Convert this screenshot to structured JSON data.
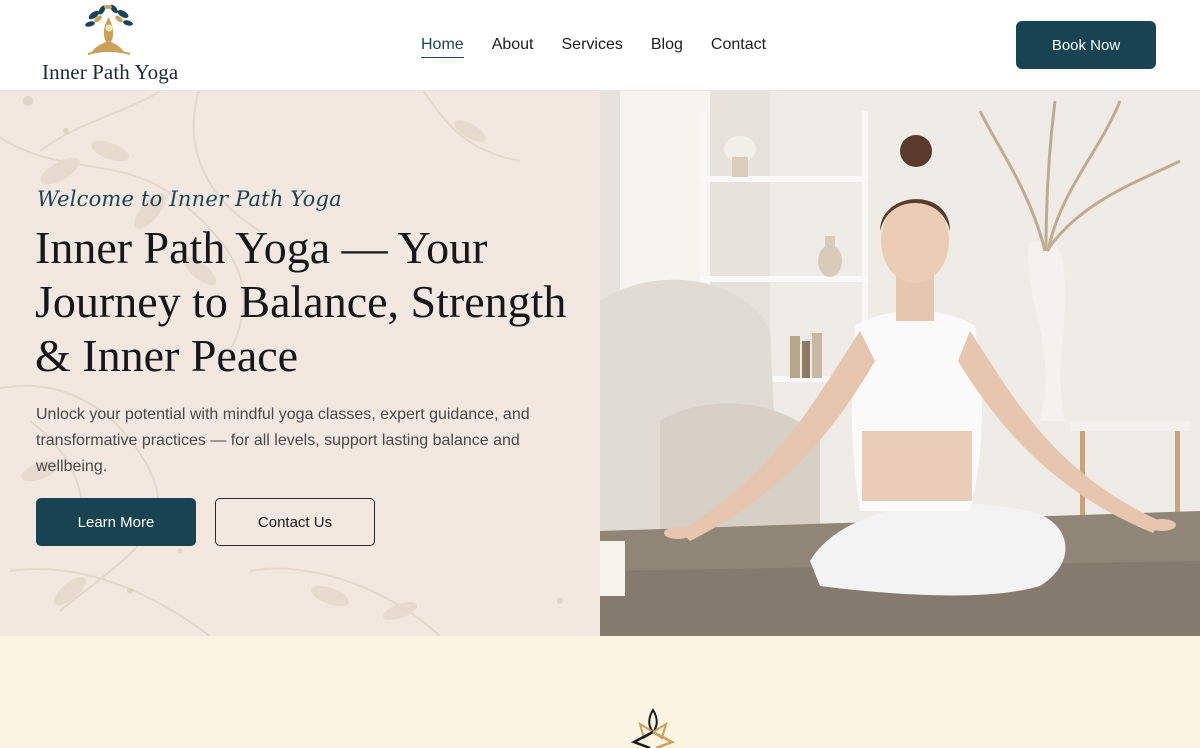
{
  "brand": {
    "name": "Inner Path Yoga",
    "colors": {
      "primary": "#174352",
      "hero_bg": "#f2e8df",
      "section_bg": "#fbf4e2",
      "gold": "#c9a15a"
    }
  },
  "header": {
    "logo_icon": "tree-meditation-logo-icon",
    "nav": [
      {
        "label": "Home",
        "active": true
      },
      {
        "label": "About",
        "active": false
      },
      {
        "label": "Services",
        "active": false
      },
      {
        "label": "Blog",
        "active": false
      },
      {
        "label": "Contact",
        "active": false
      }
    ],
    "cta_label": "Book Now"
  },
  "hero": {
    "welcome": "Welcome to Inner Path Yoga",
    "title": "Inner Path Yoga — Your Journey to Balance, Strength & Inner Peace",
    "description": "Unlock your potential with mindful yoga classes, expert guidance, and transformative practices — for all levels, support lasting balance and wellbeing.",
    "primary_button": "Learn More",
    "secondary_button": "Contact Us",
    "image_icon": "woman-meditating-photo"
  },
  "section2": {
    "icon": "lotus-person-icon"
  }
}
